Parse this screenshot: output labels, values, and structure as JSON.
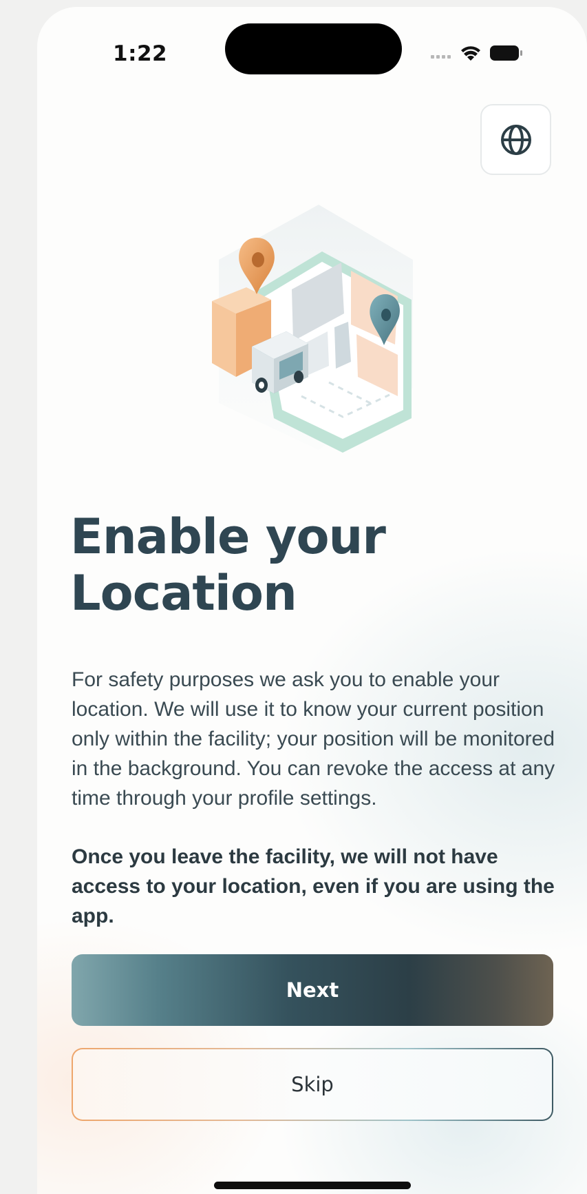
{
  "status_bar": {
    "time": "1:22",
    "signal_icon": "cellular-dots-icon",
    "wifi_icon": "wifi-icon",
    "battery_icon": "battery-icon"
  },
  "header": {
    "language_icon": "globe-icon"
  },
  "illustration": {
    "icon": "map-with-pins-and-truck-illustration",
    "colors": {
      "orange": "#e9a064",
      "teal": "#5f8f9a",
      "mint": "#a9d8cc",
      "peach": "#f9dcc8"
    }
  },
  "content": {
    "title_line1": "Enable your",
    "title_line2": "Location",
    "description": "For safety purposes we ask you to enable your location. We will use it to know your current position only within the facility; your position will be monitored in the background. You can revoke the access at any time through your profile settings.",
    "notice": "Once you leave the facility, we will not have access to your location, even if you are using the app."
  },
  "actions": {
    "next_label": "Next",
    "skip_label": "Skip"
  },
  "colors": {
    "title": "#2f4652",
    "body": "#3a4a52",
    "primary_gradient_start": "#80a6ac",
    "primary_gradient_mid": "#2c3f47",
    "primary_gradient_end": "#6e6352",
    "skip_border_start": "#eea66c",
    "skip_border_end": "#3e5a63"
  }
}
